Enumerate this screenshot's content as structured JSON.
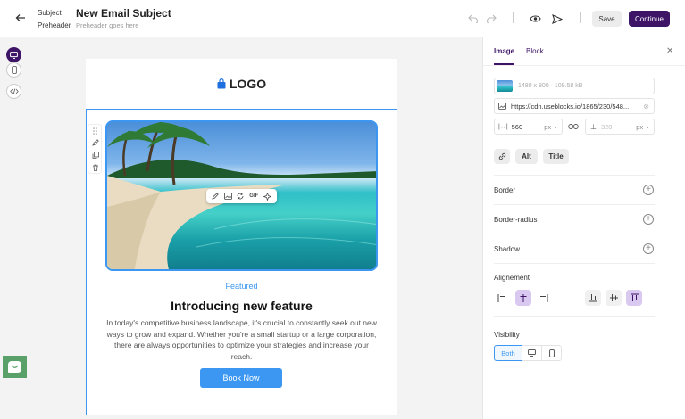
{
  "header": {
    "subject_label": "Subject",
    "subject_value": "New Email Subject",
    "preheader_label": "Preheader",
    "preheader_placeholder": "Preheader goes here",
    "save_label": "Save",
    "continue_label": "Continue"
  },
  "email": {
    "logo_text": "LOGO",
    "gif_label": "GIF",
    "featured": "Featured",
    "headline": "Introducing new feature",
    "body": "In today's competitive business landscape, it's crucial to constantly seek out new ways to grow and expand. Whether you're a small startup or a large corporation, there are always opportunities to optimize your strategies and increase your reach.",
    "cta": "Book Now"
  },
  "panel": {
    "tabs": [
      "Image",
      "Block"
    ],
    "image_meta": "1480 x 800 · 109.58 kB",
    "image_url": "https://cdn.useblocks.io/1865/230/548...",
    "width_value": "560",
    "width_unit": "px",
    "height_value": "320",
    "height_unit": "px",
    "alt_label": "Alt",
    "title_label": "Title",
    "border_label": "Border",
    "radius_label": "Border-radius",
    "shadow_label": "Shadow",
    "alignment_label": "Alignement",
    "visibility_label": "Visibility",
    "visibility_both": "Both"
  },
  "colors": {
    "brand": "#3d1466",
    "accent": "#3b97f2",
    "active_align": "#d9c8ef",
    "chat": "#5aa069"
  }
}
